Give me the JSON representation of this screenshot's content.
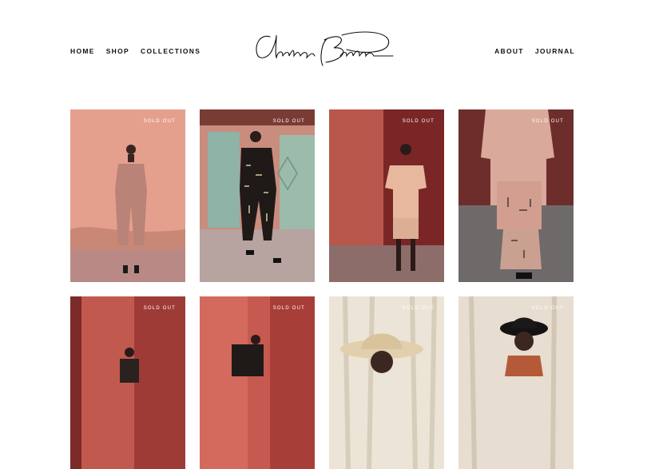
{
  "nav_left": [
    "HOME",
    "SHOP",
    "COLLECTIONS"
  ],
  "nav_right": [
    "ABOUT",
    "JOURNAL"
  ],
  "logo_alt": "Chelsea Bravo",
  "badge_text": "SOLD OUT",
  "products": [
    {
      "name": "product-1",
      "badge": "SOLD OUT"
    },
    {
      "name": "product-2",
      "badge": "SOLD OUT"
    },
    {
      "name": "product-3",
      "badge": "SOLD OUT"
    },
    {
      "name": "product-4",
      "badge": "SOLD OUT"
    },
    {
      "name": "product-5",
      "badge": "SOLD OUT"
    },
    {
      "name": "product-6",
      "badge": "SOLD OUT"
    },
    {
      "name": "product-7",
      "badge": "SOLD OUT"
    },
    {
      "name": "product-8",
      "badge": "SOLD OUT"
    }
  ],
  "colors": {
    "text": "#111111",
    "terracotta": "#c97a6e",
    "deep_red": "#9c3a35",
    "cream": "#ece4d6"
  }
}
